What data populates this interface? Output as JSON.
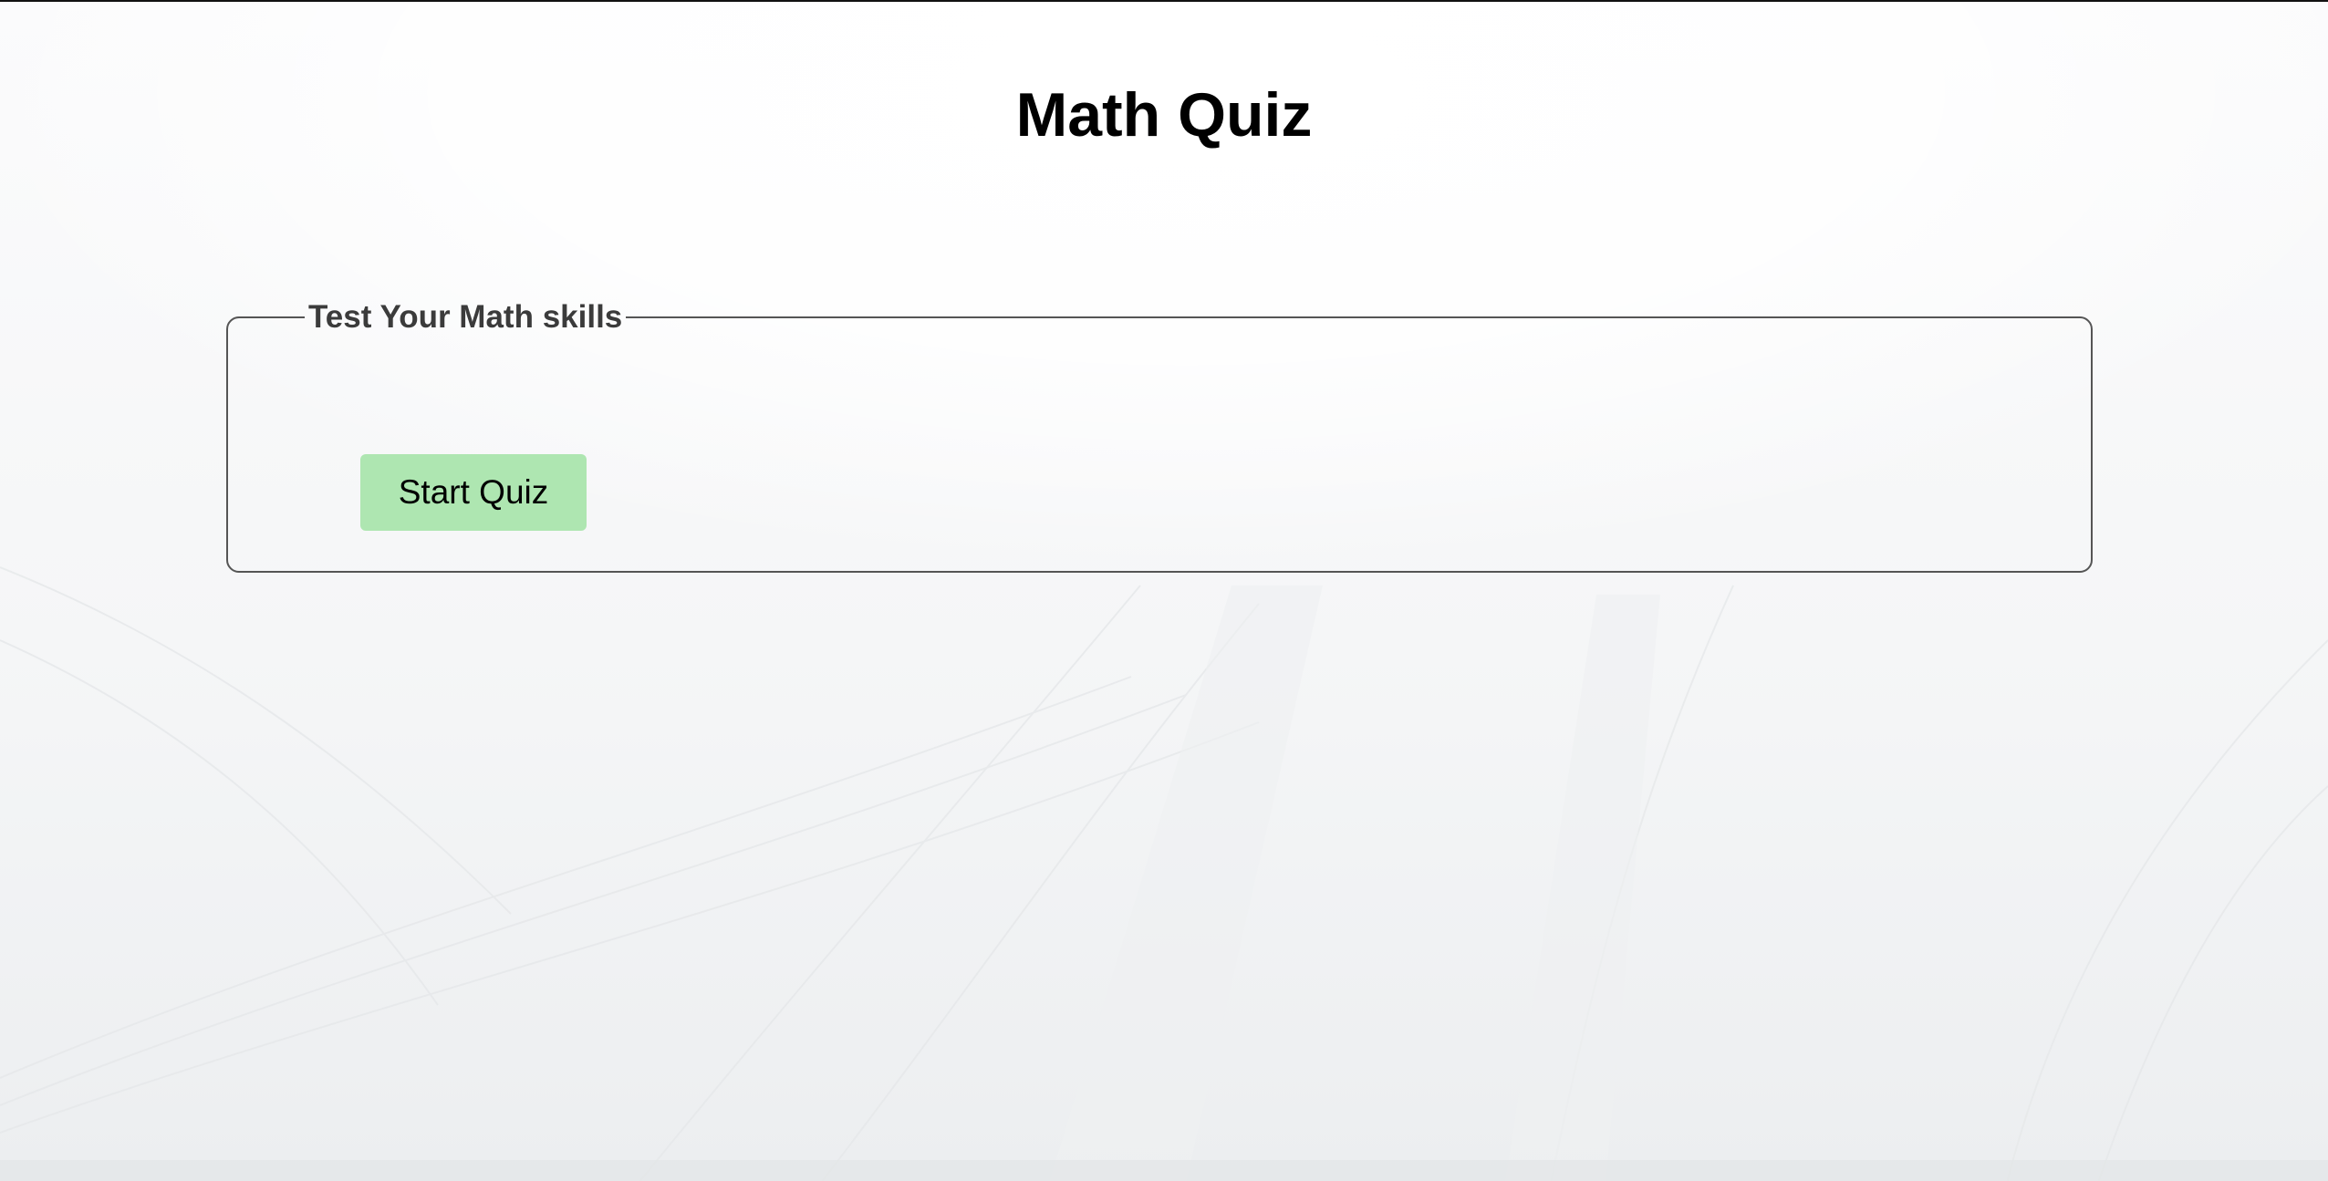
{
  "page": {
    "title": "Math Quiz"
  },
  "quiz_section": {
    "legend": "Test Your Math skills",
    "start_button_label": "Start Quiz"
  },
  "colors": {
    "button_bg": "#aee6b1",
    "title_text": "#000000",
    "legend_text": "#3b3b3b",
    "border": "#555555"
  }
}
